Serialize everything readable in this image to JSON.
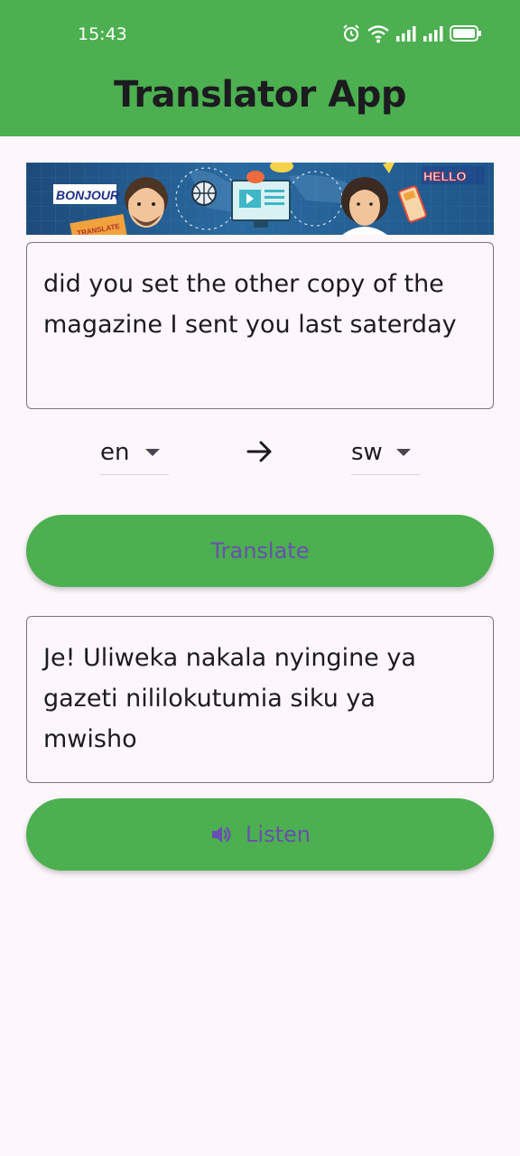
{
  "status_bar": {
    "time": "15:43",
    "icons": [
      "alarm-icon",
      "wifi-icon",
      "signal-icon",
      "signal-icon",
      "battery-icon"
    ]
  },
  "app_bar": {
    "title": "Translator App"
  },
  "banner": {
    "text_left": "BONJOUR",
    "text_right": "HELLO",
    "text_sign": "TRANSLATE"
  },
  "input": {
    "value": "did you set the other copy of the magazine I sent you last saterday"
  },
  "language": {
    "from": "en",
    "to": "sw"
  },
  "translate_button": {
    "label": "Translate"
  },
  "output": {
    "value": "Je! Uliweka nakala nyingine ya gazeti nililokutumia siku ya mwisho"
  },
  "listen_button": {
    "label": "Listen",
    "icon": "speaker-icon"
  },
  "colors": {
    "accent": "#4caf50",
    "button_text": "#6a4fb0",
    "background": "#fdf7fc"
  }
}
